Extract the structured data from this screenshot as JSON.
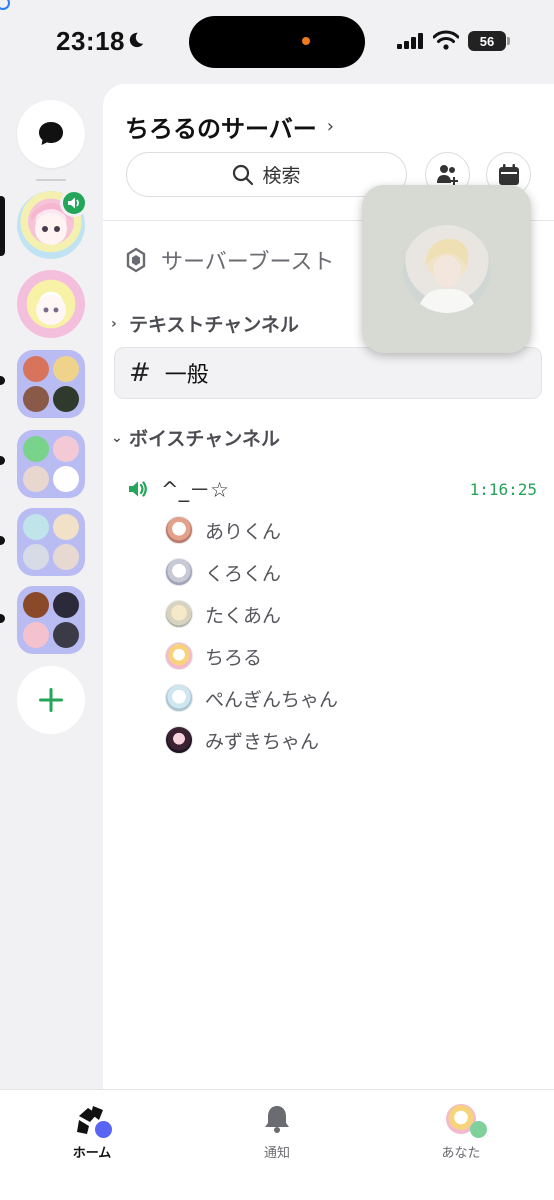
{
  "status_bar": {
    "time": "23:18",
    "battery": "56"
  },
  "server": {
    "name": "ちろるのサーバー"
  },
  "search": {
    "label": "検索"
  },
  "boost": {
    "label": "サーバーブースト"
  },
  "categories": {
    "text": {
      "label": "テキストチャンネル"
    },
    "voice": {
      "label": "ボイスチャンネル"
    }
  },
  "text_channels": [
    {
      "name": "一般"
    }
  ],
  "voice_channel": {
    "name": "^_－☆",
    "elapsed": "1:16:25",
    "members": [
      "ありくん",
      "くろくん",
      "たくあん",
      "ちろる",
      "ぺんぎんちゃん",
      "みずきちゃん"
    ]
  },
  "bottom_nav": {
    "home": "ホーム",
    "notifications": "通知",
    "you": "あなた"
  },
  "colors": {
    "accent_green": "#23a55a",
    "folder_bg": "#b9bcf3",
    "home_status": "#5865f2",
    "you_status": "#7fd09b"
  },
  "icons": [
    "dm-bubble-icon",
    "plus-icon",
    "search-icon",
    "add-member-icon",
    "calendar-icon",
    "boost-shield-icon",
    "hash-icon",
    "speaker-icon",
    "home-icon",
    "bell-icon"
  ]
}
